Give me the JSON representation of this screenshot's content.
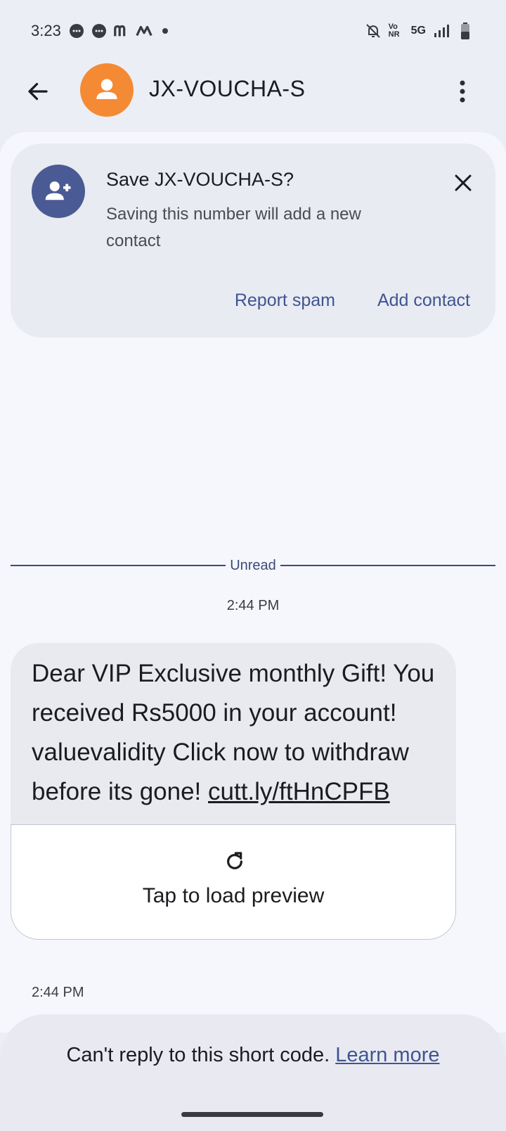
{
  "status": {
    "time": "3:23",
    "network": "5G",
    "volte": "Vo NR"
  },
  "app_bar": {
    "title": "JX-VOUCHA-S"
  },
  "save_card": {
    "title": "Save JX-VOUCHA-S?",
    "subtitle": "Saving this number will add a new contact",
    "report_spam": "Report spam",
    "add_contact": "Add contact"
  },
  "conversation": {
    "unread_label": "Unread",
    "timestamp_top": "2:44 PM",
    "message_text": "Dear VIP Exclusive monthly Gift! You received Rs5000 in your account! valuevalidity  Click now to withdraw before its gone! ",
    "message_link": "cutt.ly/ftHnCPFB",
    "preview_label": "Tap to load preview",
    "timestamp_bottom": "2:44 PM"
  },
  "footer": {
    "notice": "Can't reply to this short code. ",
    "learn_more": "Learn more"
  },
  "colors": {
    "avatar": "#f58a34",
    "add_person": "#4a5a94",
    "accent": "#3f5592"
  }
}
